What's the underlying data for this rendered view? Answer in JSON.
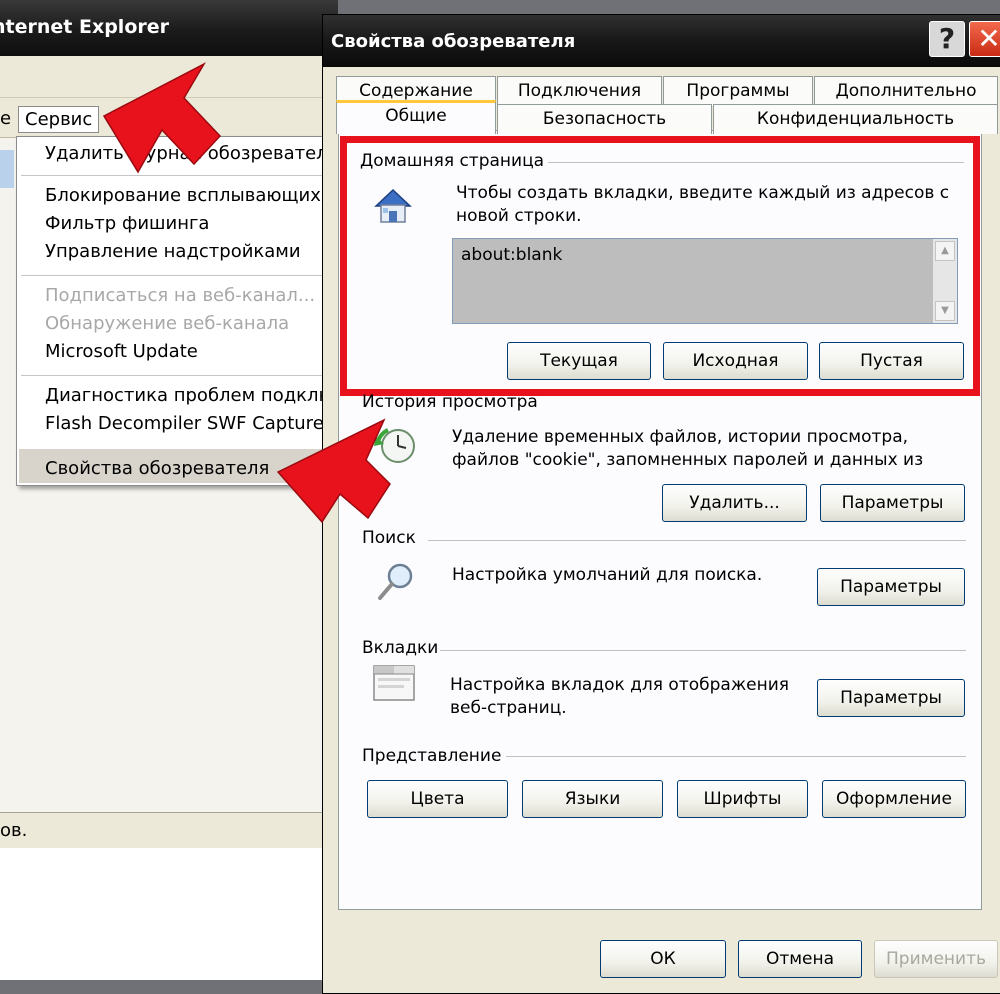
{
  "background_window": {
    "title": "nternet Explorer",
    "menu": {
      "left_fragment": "е",
      "service": "Сервис"
    },
    "status_text": "ов.",
    "dropdown_items": [
      {
        "label": "Удалить журнал обозревателя...",
        "disabled": false
      },
      {
        "label": "Блокирование всплывающих окон",
        "disabled": false
      },
      {
        "label": "Фильтр фишинга",
        "disabled": false
      },
      {
        "label": "Управление надстройками",
        "disabled": false
      },
      {
        "label": "Подписаться на веб-канал...",
        "disabled": true
      },
      {
        "label": "Обнаружение веб-канала",
        "disabled": true
      },
      {
        "label": "Microsoft Update",
        "disabled": false
      },
      {
        "label": "Диагностика проблем подключения",
        "disabled": false
      },
      {
        "label": "Flash Decompiler SWF Capture tool",
        "disabled": false
      },
      {
        "label": "Свойства обозревателя",
        "disabled": false
      }
    ]
  },
  "dialog": {
    "title": "Свойства обозревателя",
    "help": "?",
    "close": "✕",
    "tabs_row1": [
      "Содержание",
      "Подключения",
      "Программы",
      "Дополнительно"
    ],
    "tabs_row2": [
      "Общие",
      "Безопасность",
      "Конфиденциальность"
    ],
    "active_tab": "Общие",
    "home_page": {
      "label": "Домашняя страница",
      "description_line1": "Чтобы создать вкладки, введите каждый из адресов с",
      "description_line2": "новой строки.",
      "value": "about:blank",
      "buttons": [
        "Текущая",
        "Исходная",
        "Пустая"
      ]
    },
    "history": {
      "label": "История просмотра",
      "description_line1": "Удаление временных файлов, истории просмотра,",
      "description_line2": "файлов \"cookie\", запомненных паролей и данных из",
      "buttons": [
        "Удалить...",
        "Параметры"
      ]
    },
    "search": {
      "label": "Поиск",
      "description": "Настройка умолчаний для поиска.",
      "button": "Параметры"
    },
    "tabs_section": {
      "label": "Вкладки",
      "description_line1": "Настройка вкладок для отображения",
      "description_line2": "веб-страниц.",
      "button": "Параметры"
    },
    "appearance": {
      "label": "Представление",
      "buttons": [
        "Цвета",
        "Языки",
        "Шрифты",
        "Оформление"
      ]
    },
    "footer": {
      "ok": "ОК",
      "cancel": "Отмена",
      "apply": "Применить"
    }
  },
  "colors": {
    "highlight_box": "#e8121c",
    "arrow": "#e8121c",
    "active_tab_accent": "#ffc83c"
  }
}
